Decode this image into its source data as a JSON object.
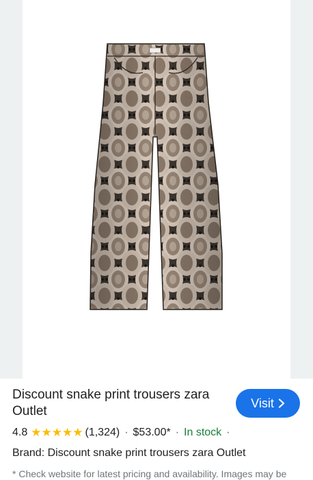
{
  "product": {
    "image_alt": "Discount snake print trousers zara Outlet",
    "title": "Discount snake print trousers zara Outlet",
    "visit_label": "Visit",
    "rating": "4.8",
    "rating_stars": 4.8,
    "review_count": "(1,324)",
    "price": "$53.00*",
    "stock_status": "In stock",
    "brand_line": "Brand: Discount snake print trousers zara Outlet",
    "disclaimer": "* Check website for latest pricing and availability. Images may be"
  },
  "colors": {
    "accent": "#1a73e8",
    "star": "#fbbc04",
    "in_stock": "#188038",
    "image_backdrop": "#eef1f2"
  },
  "icons": {
    "visit_chevron": "chevron-right-icon",
    "rating": "star-icon"
  }
}
